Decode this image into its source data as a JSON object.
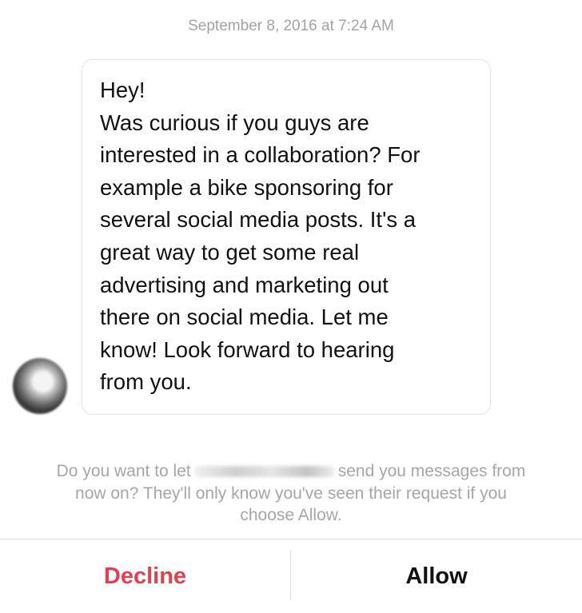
{
  "conversation": {
    "timestamp": "September 8, 2016 at 7:24 AM",
    "message_lines": [
      "Hey!",
      "Was curious if you guys are",
      "interested in a collaboration? For",
      "example a bike sponsoring for",
      "several social media posts. It's a",
      "great way to get some real",
      "advertising and marketing out",
      "there on social media. Let me",
      "know! Look forward to hearing",
      "from you."
    ]
  },
  "request_prompt": {
    "line1_before": "Do you want to let",
    "line1_after": "send you messages from",
    "line2": "now on? They'll only know you've seen their request if you",
    "line3": "choose Allow."
  },
  "actions": {
    "decline_label": "Decline",
    "allow_label": "Allow",
    "decline_color": "#e0404f"
  }
}
